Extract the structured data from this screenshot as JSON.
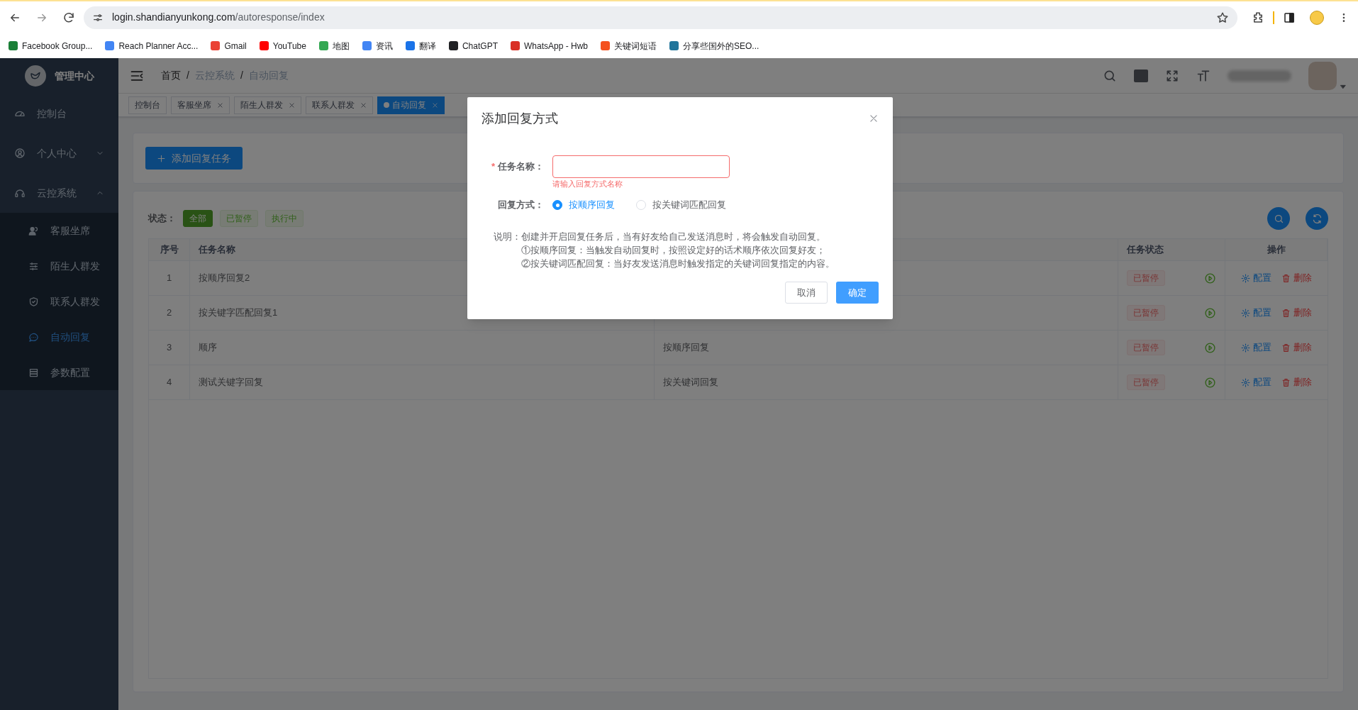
{
  "browser": {
    "url_host": "login.shandianyunkong.com",
    "url_path": "/autoresponse/index",
    "bookmarks": [
      {
        "label": "Facebook Group...",
        "color": "#1a7f37"
      },
      {
        "label": "Reach Planner Acc...",
        "color": "#4285f4"
      },
      {
        "label": "Gmail",
        "color": "#ea4335"
      },
      {
        "label": "YouTube",
        "color": "#ff0000"
      },
      {
        "label": "地图",
        "color": "#34a853"
      },
      {
        "label": "资讯",
        "color": "#4285f4"
      },
      {
        "label": "翻译",
        "color": "#1a73e8"
      },
      {
        "label": "ChatGPT",
        "color": "#202124"
      },
      {
        "label": "WhatsApp - Hwb",
        "color": "#d93025"
      },
      {
        "label": "关键词短语",
        "color": "#f4511e"
      },
      {
        "label": "分享些国外的SEO...",
        "color": "#21759b"
      }
    ]
  },
  "sidebar": {
    "title": "管理中心",
    "items": [
      {
        "label": "控制台",
        "kind": "link",
        "selected": false
      },
      {
        "label": "个人中心",
        "kind": "group",
        "expanded": false
      },
      {
        "label": "云控系统",
        "kind": "group",
        "expanded": true,
        "children": [
          {
            "label": "客服坐席",
            "selected": false
          },
          {
            "label": "陌生人群发",
            "selected": false
          },
          {
            "label": "联系人群发",
            "selected": false
          },
          {
            "label": "自动回复",
            "selected": true
          },
          {
            "label": "参数配置",
            "selected": false
          }
        ]
      }
    ]
  },
  "breadcrumb": {
    "separator": "/",
    "items": [
      "首页",
      "云控系统",
      "自动回复"
    ]
  },
  "tabs": [
    {
      "label": "控制台",
      "selected": false,
      "closable": false
    },
    {
      "label": "客服坐席",
      "selected": false,
      "closable": true
    },
    {
      "label": "陌生人群发",
      "selected": false,
      "closable": true
    },
    {
      "label": "联系人群发",
      "selected": false,
      "closable": true
    },
    {
      "label": "自动回复",
      "selected": true,
      "closable": true
    }
  ],
  "add_button": "添加回复任务",
  "filter": {
    "label": "状态：",
    "options": [
      {
        "label": "全部",
        "selected": true
      },
      {
        "label": "已暂停",
        "selected": false
      },
      {
        "label": "执行中",
        "selected": false
      }
    ]
  },
  "table": {
    "columns": [
      "序号",
      "任务名称",
      "任务状态",
      "操作"
    ],
    "rows": [
      {
        "index": "1",
        "name": "按顺序回复2",
        "status": "已暂停",
        "config": "配置",
        "delete": "删除"
      },
      {
        "index": "2",
        "name": "按关键字匹配回复1",
        "status": "已暂停",
        "config": "配置",
        "delete": "删除"
      },
      {
        "index": "3",
        "name": "顺序",
        "column_3": "按顺序回复",
        "status": "已暂停",
        "config": "配置",
        "delete": "删除"
      },
      {
        "index": "4",
        "name": "测试关键字回复",
        "column_3": "按关键词回复",
        "status": "已暂停",
        "config": "配置",
        "delete": "删除"
      }
    ]
  },
  "modal": {
    "title": "添加回复方式",
    "name_field": {
      "label": "任务名称：",
      "required_mark": "*",
      "invalid": true,
      "error": "请输入回复方式名称"
    },
    "mode_field": {
      "label": "回复方式：",
      "options": [
        {
          "label": "按顺序回复",
          "selected": true
        },
        {
          "label": "按关键词匹配回复",
          "selected": false
        }
      ]
    },
    "note": {
      "label": "说明：",
      "lines": [
        "创建并开启回复任务后，当有好友给自己发送消息时，将会触发自动回复。",
        "①按顺序回复：当触发自动回复时，按照设定好的话术顺序依次回复好友；",
        "②按关键词匹配回复：当好友发送消息时触发指定的关键词回复指定的内容。"
      ]
    },
    "cancel": "取消",
    "confirm": "确定"
  }
}
